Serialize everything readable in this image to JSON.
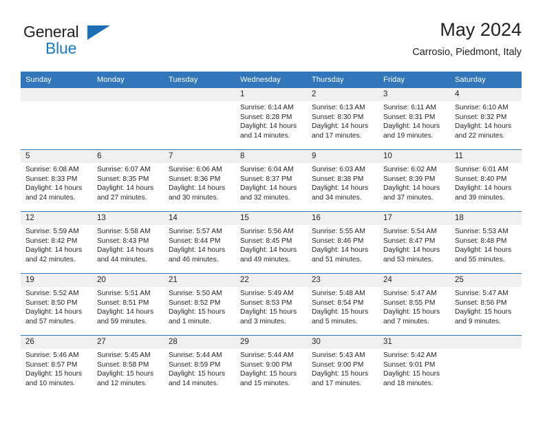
{
  "brand": {
    "name_part1": "General",
    "name_part2": "Blue",
    "triangle_icon": "brand-triangle-icon",
    "color_dark": "#231f20",
    "color_blue": "#1b7ac4"
  },
  "header": {
    "title": "May 2024",
    "subtitle": "Carrosio, Piedmont, Italy"
  },
  "theme": {
    "header_blue": "#3176b8",
    "daynum_band": "#f0f0f0",
    "text": "#231f20"
  },
  "weekday_headers": [
    "Sunday",
    "Monday",
    "Tuesday",
    "Wednesday",
    "Thursday",
    "Friday",
    "Saturday"
  ],
  "weeks": [
    [
      {
        "day": "",
        "empty": true,
        "sunrise": "",
        "sunset": "",
        "daylight_line1": "",
        "daylight_line2": ""
      },
      {
        "day": "",
        "empty": true,
        "sunrise": "",
        "sunset": "",
        "daylight_line1": "",
        "daylight_line2": ""
      },
      {
        "day": "",
        "empty": true,
        "sunrise": "",
        "sunset": "",
        "daylight_line1": "",
        "daylight_line2": ""
      },
      {
        "day": "1",
        "empty": false,
        "sunrise": "Sunrise: 6:14 AM",
        "sunset": "Sunset: 8:28 PM",
        "daylight_line1": "Daylight: 14 hours",
        "daylight_line2": "and 14 minutes."
      },
      {
        "day": "2",
        "empty": false,
        "sunrise": "Sunrise: 6:13 AM",
        "sunset": "Sunset: 8:30 PM",
        "daylight_line1": "Daylight: 14 hours",
        "daylight_line2": "and 17 minutes."
      },
      {
        "day": "3",
        "empty": false,
        "sunrise": "Sunrise: 6:11 AM",
        "sunset": "Sunset: 8:31 PM",
        "daylight_line1": "Daylight: 14 hours",
        "daylight_line2": "and 19 minutes."
      },
      {
        "day": "4",
        "empty": false,
        "sunrise": "Sunrise: 6:10 AM",
        "sunset": "Sunset: 8:32 PM",
        "daylight_line1": "Daylight: 14 hours",
        "daylight_line2": "and 22 minutes."
      }
    ],
    [
      {
        "day": "5",
        "empty": false,
        "sunrise": "Sunrise: 6:08 AM",
        "sunset": "Sunset: 8:33 PM",
        "daylight_line1": "Daylight: 14 hours",
        "daylight_line2": "and 24 minutes."
      },
      {
        "day": "6",
        "empty": false,
        "sunrise": "Sunrise: 6:07 AM",
        "sunset": "Sunset: 8:35 PM",
        "daylight_line1": "Daylight: 14 hours",
        "daylight_line2": "and 27 minutes."
      },
      {
        "day": "7",
        "empty": false,
        "sunrise": "Sunrise: 6:06 AM",
        "sunset": "Sunset: 8:36 PM",
        "daylight_line1": "Daylight: 14 hours",
        "daylight_line2": "and 30 minutes."
      },
      {
        "day": "8",
        "empty": false,
        "sunrise": "Sunrise: 6:04 AM",
        "sunset": "Sunset: 8:37 PM",
        "daylight_line1": "Daylight: 14 hours",
        "daylight_line2": "and 32 minutes."
      },
      {
        "day": "9",
        "empty": false,
        "sunrise": "Sunrise: 6:03 AM",
        "sunset": "Sunset: 8:38 PM",
        "daylight_line1": "Daylight: 14 hours",
        "daylight_line2": "and 34 minutes."
      },
      {
        "day": "10",
        "empty": false,
        "sunrise": "Sunrise: 6:02 AM",
        "sunset": "Sunset: 8:39 PM",
        "daylight_line1": "Daylight: 14 hours",
        "daylight_line2": "and 37 minutes."
      },
      {
        "day": "11",
        "empty": false,
        "sunrise": "Sunrise: 6:01 AM",
        "sunset": "Sunset: 8:40 PM",
        "daylight_line1": "Daylight: 14 hours",
        "daylight_line2": "and 39 minutes."
      }
    ],
    [
      {
        "day": "12",
        "empty": false,
        "sunrise": "Sunrise: 5:59 AM",
        "sunset": "Sunset: 8:42 PM",
        "daylight_line1": "Daylight: 14 hours",
        "daylight_line2": "and 42 minutes."
      },
      {
        "day": "13",
        "empty": false,
        "sunrise": "Sunrise: 5:58 AM",
        "sunset": "Sunset: 8:43 PM",
        "daylight_line1": "Daylight: 14 hours",
        "daylight_line2": "and 44 minutes."
      },
      {
        "day": "14",
        "empty": false,
        "sunrise": "Sunrise: 5:57 AM",
        "sunset": "Sunset: 8:44 PM",
        "daylight_line1": "Daylight: 14 hours",
        "daylight_line2": "and 46 minutes."
      },
      {
        "day": "15",
        "empty": false,
        "sunrise": "Sunrise: 5:56 AM",
        "sunset": "Sunset: 8:45 PM",
        "daylight_line1": "Daylight: 14 hours",
        "daylight_line2": "and 49 minutes."
      },
      {
        "day": "16",
        "empty": false,
        "sunrise": "Sunrise: 5:55 AM",
        "sunset": "Sunset: 8:46 PM",
        "daylight_line1": "Daylight: 14 hours",
        "daylight_line2": "and 51 minutes."
      },
      {
        "day": "17",
        "empty": false,
        "sunrise": "Sunrise: 5:54 AM",
        "sunset": "Sunset: 8:47 PM",
        "daylight_line1": "Daylight: 14 hours",
        "daylight_line2": "and 53 minutes."
      },
      {
        "day": "18",
        "empty": false,
        "sunrise": "Sunrise: 5:53 AM",
        "sunset": "Sunset: 8:48 PM",
        "daylight_line1": "Daylight: 14 hours",
        "daylight_line2": "and 55 minutes."
      }
    ],
    [
      {
        "day": "19",
        "empty": false,
        "sunrise": "Sunrise: 5:52 AM",
        "sunset": "Sunset: 8:50 PM",
        "daylight_line1": "Daylight: 14 hours",
        "daylight_line2": "and 57 minutes."
      },
      {
        "day": "20",
        "empty": false,
        "sunrise": "Sunrise: 5:51 AM",
        "sunset": "Sunset: 8:51 PM",
        "daylight_line1": "Daylight: 14 hours",
        "daylight_line2": "and 59 minutes."
      },
      {
        "day": "21",
        "empty": false,
        "sunrise": "Sunrise: 5:50 AM",
        "sunset": "Sunset: 8:52 PM",
        "daylight_line1": "Daylight: 15 hours",
        "daylight_line2": "and 1 minute."
      },
      {
        "day": "22",
        "empty": false,
        "sunrise": "Sunrise: 5:49 AM",
        "sunset": "Sunset: 8:53 PM",
        "daylight_line1": "Daylight: 15 hours",
        "daylight_line2": "and 3 minutes."
      },
      {
        "day": "23",
        "empty": false,
        "sunrise": "Sunrise: 5:48 AM",
        "sunset": "Sunset: 8:54 PM",
        "daylight_line1": "Daylight: 15 hours",
        "daylight_line2": "and 5 minutes."
      },
      {
        "day": "24",
        "empty": false,
        "sunrise": "Sunrise: 5:47 AM",
        "sunset": "Sunset: 8:55 PM",
        "daylight_line1": "Daylight: 15 hours",
        "daylight_line2": "and 7 minutes."
      },
      {
        "day": "25",
        "empty": false,
        "sunrise": "Sunrise: 5:47 AM",
        "sunset": "Sunset: 8:56 PM",
        "daylight_line1": "Daylight: 15 hours",
        "daylight_line2": "and 9 minutes."
      }
    ],
    [
      {
        "day": "26",
        "empty": false,
        "sunrise": "Sunrise: 5:46 AM",
        "sunset": "Sunset: 8:57 PM",
        "daylight_line1": "Daylight: 15 hours",
        "daylight_line2": "and 10 minutes."
      },
      {
        "day": "27",
        "empty": false,
        "sunrise": "Sunrise: 5:45 AM",
        "sunset": "Sunset: 8:58 PM",
        "daylight_line1": "Daylight: 15 hours",
        "daylight_line2": "and 12 minutes."
      },
      {
        "day": "28",
        "empty": false,
        "sunrise": "Sunrise: 5:44 AM",
        "sunset": "Sunset: 8:59 PM",
        "daylight_line1": "Daylight: 15 hours",
        "daylight_line2": "and 14 minutes."
      },
      {
        "day": "29",
        "empty": false,
        "sunrise": "Sunrise: 5:44 AM",
        "sunset": "Sunset: 9:00 PM",
        "daylight_line1": "Daylight: 15 hours",
        "daylight_line2": "and 15 minutes."
      },
      {
        "day": "30",
        "empty": false,
        "sunrise": "Sunrise: 5:43 AM",
        "sunset": "Sunset: 9:00 PM",
        "daylight_line1": "Daylight: 15 hours",
        "daylight_line2": "and 17 minutes."
      },
      {
        "day": "31",
        "empty": false,
        "sunrise": "Sunrise: 5:42 AM",
        "sunset": "Sunset: 9:01 PM",
        "daylight_line1": "Daylight: 15 hours",
        "daylight_line2": "and 18 minutes."
      },
      {
        "day": "",
        "empty": true,
        "sunrise": "",
        "sunset": "",
        "daylight_line1": "",
        "daylight_line2": ""
      }
    ]
  ]
}
